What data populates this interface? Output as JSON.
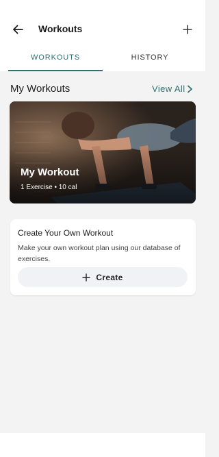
{
  "header": {
    "title": "Workouts",
    "back_icon": "arrow-left-icon",
    "add_icon": "plus-icon"
  },
  "tabs": [
    {
      "label": "WORKOUTS",
      "active": true
    },
    {
      "label": "HISTORY",
      "active": false
    }
  ],
  "section": {
    "title": "My Workouts",
    "view_all": "View All"
  },
  "workout_card": {
    "title": "My Workout",
    "meta": "1 Exercise • 10 cal"
  },
  "create_card": {
    "title": "Create Your Own Workout",
    "description": "Make your own workout plan using our database of exercises.",
    "button_label": "Create"
  },
  "colors": {
    "accent": "#2e6f73",
    "background": "#f3f3f3"
  }
}
